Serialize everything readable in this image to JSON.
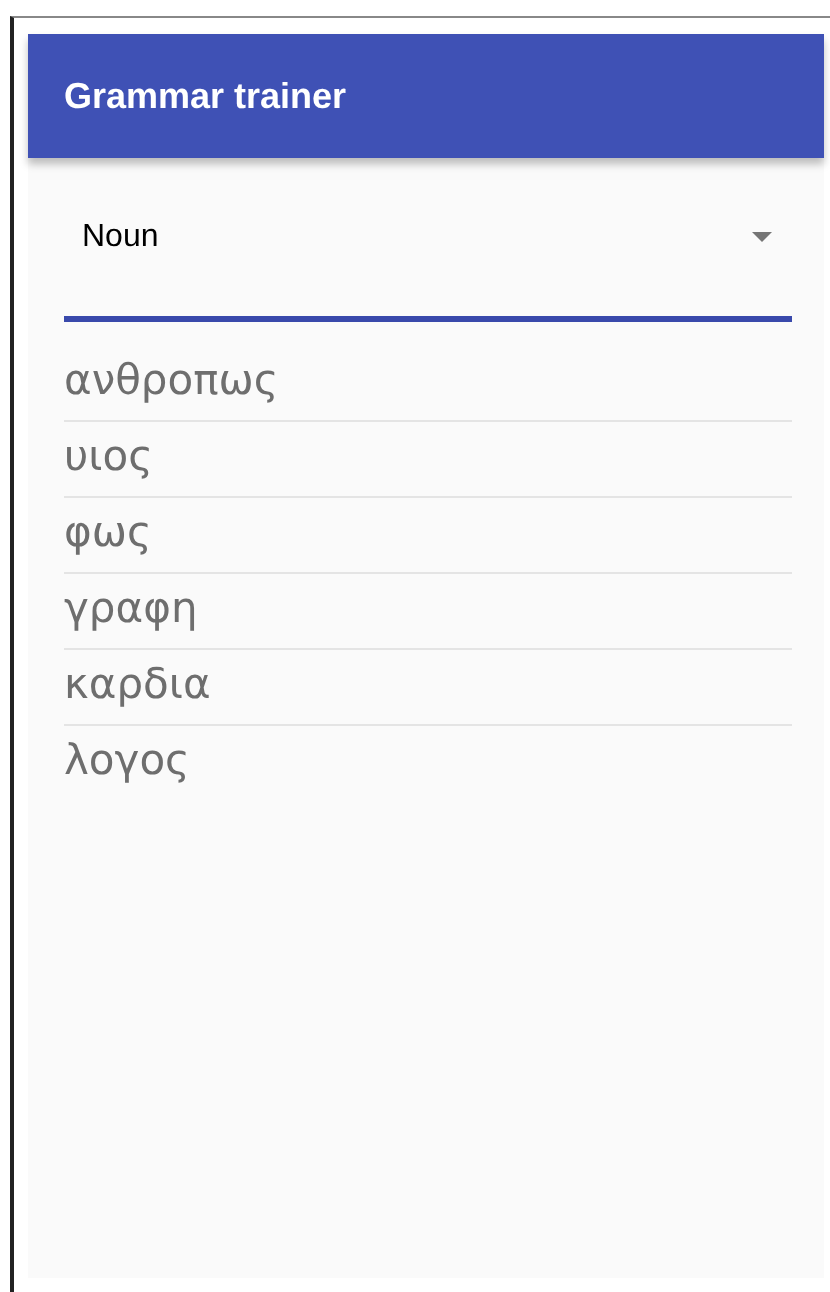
{
  "app_bar": {
    "title": "Grammar trainer"
  },
  "dropdown": {
    "value": "Noun"
  },
  "words": [
    "ανθροπως",
    "υιος",
    "φως",
    "γραφη",
    "καρδια",
    "λογος"
  ]
}
